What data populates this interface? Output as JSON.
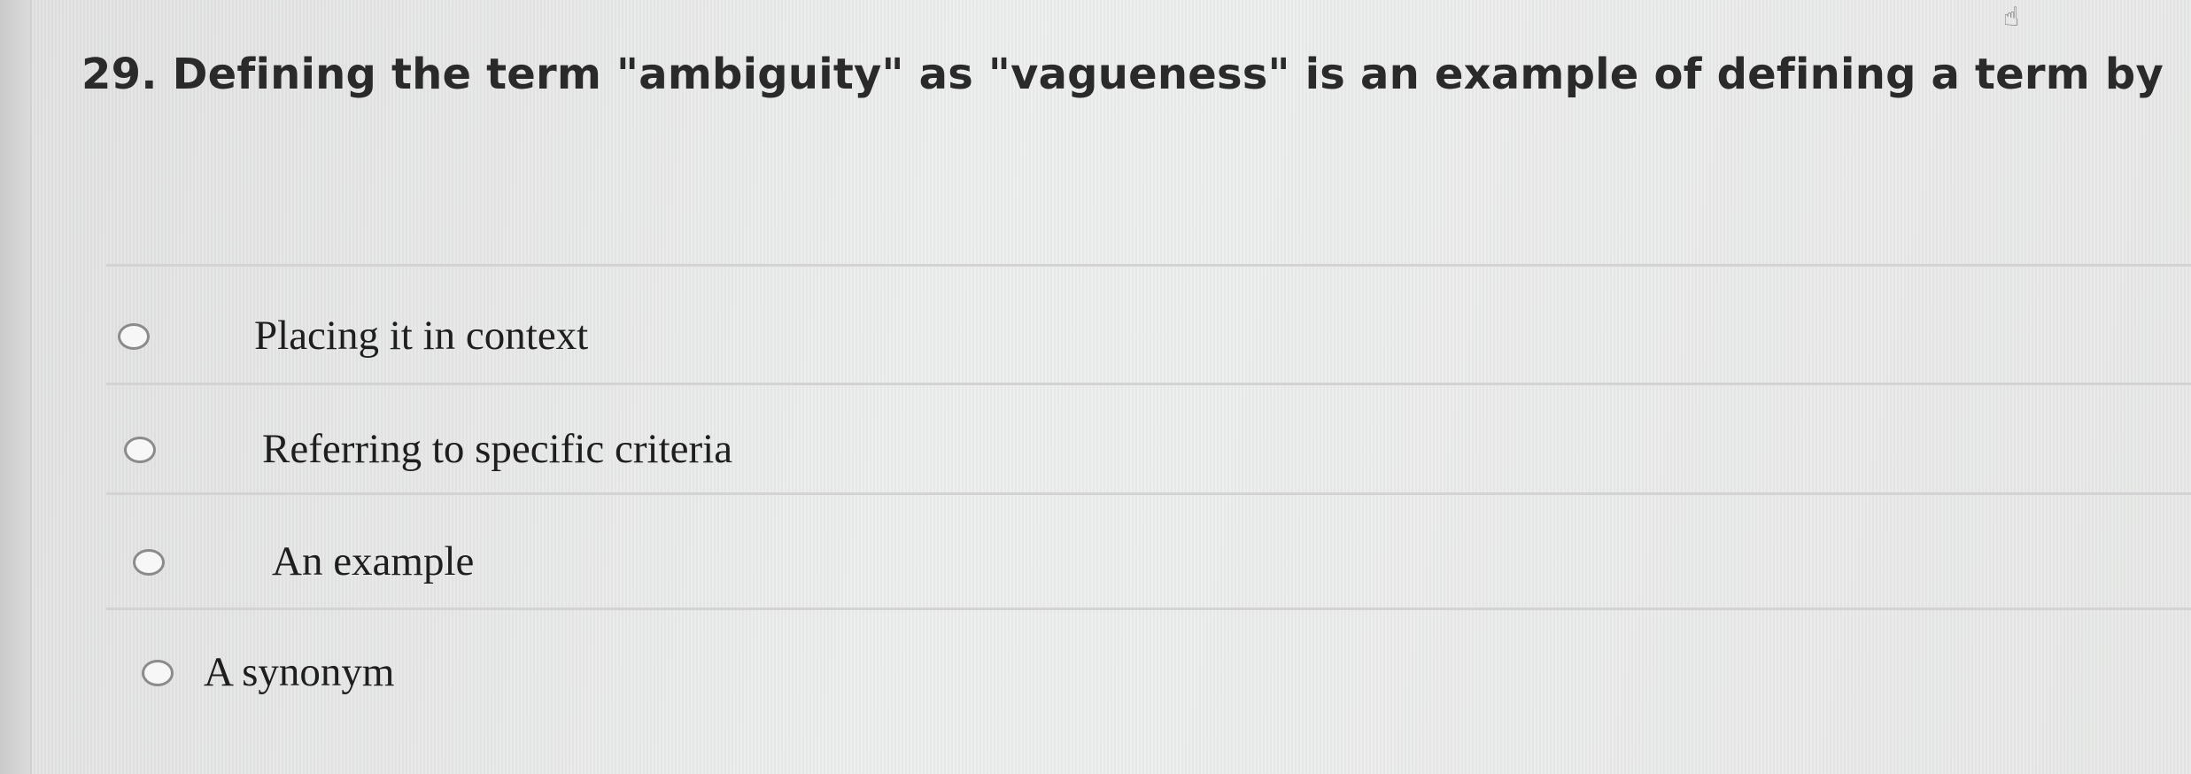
{
  "question": {
    "number": "29.",
    "text": "Defining the term \"ambiguity\" as \"vagueness\" is an example of defining a term by"
  },
  "options": [
    {
      "label": "Placing it in context",
      "selected": false
    },
    {
      "label": "Referring to specific criteria",
      "selected": false
    },
    {
      "label": "An example",
      "selected": false
    },
    {
      "label": "A synonym",
      "selected": false
    }
  ],
  "cursor_icon": "pointer-cursor-icon"
}
